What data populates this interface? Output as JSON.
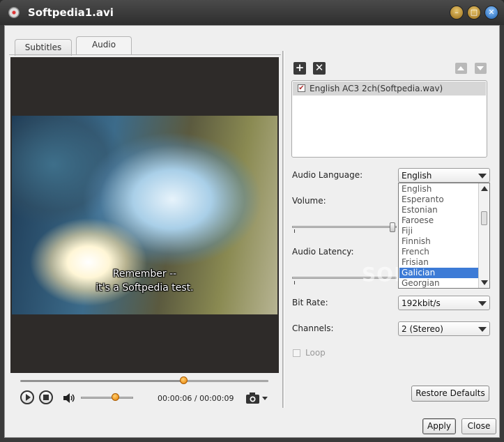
{
  "window": {
    "title": "Softpedia1.avi"
  },
  "tabs": [
    {
      "label": "Subtitles"
    },
    {
      "label": "Audio",
      "active": true
    }
  ],
  "video": {
    "subtitle_line1": "Remember --",
    "subtitle_line2": "it's a Softpedia test."
  },
  "player": {
    "time": "00:00:06 / 00:00:09",
    "seek_position": 0.66,
    "volume_level": 0.66
  },
  "tracks": {
    "items": [
      {
        "label": "English AC3 2ch(Softpedia.wav)",
        "checked": true
      }
    ]
  },
  "form": {
    "audio_language_label": "Audio Language:",
    "audio_language_value": "English",
    "volume_label": "Volume:",
    "audio_latency_label": "Audio Latency:",
    "bit_rate_label": "Bit Rate:",
    "bit_rate_value": "192kbit/s",
    "channels_label": "Channels:",
    "channels_value": "2 (Stereo)",
    "loop_label": "Loop"
  },
  "language_dropdown": {
    "options": [
      "English",
      "Esperanto",
      "Estonian",
      "Faroese",
      "Fiji",
      "Finnish",
      "French",
      "Frisian",
      "Galician",
      "Georgian"
    ],
    "selected": "Galician"
  },
  "buttons": {
    "restore_defaults": "Restore Defaults",
    "apply": "Apply",
    "close": "Close"
  },
  "watermark": "SOFTPEDIA",
  "colors": {
    "knob_orange": "#e67d00",
    "selection_blue": "#3d7bd6",
    "close_button_blue": "#1b5fae"
  }
}
